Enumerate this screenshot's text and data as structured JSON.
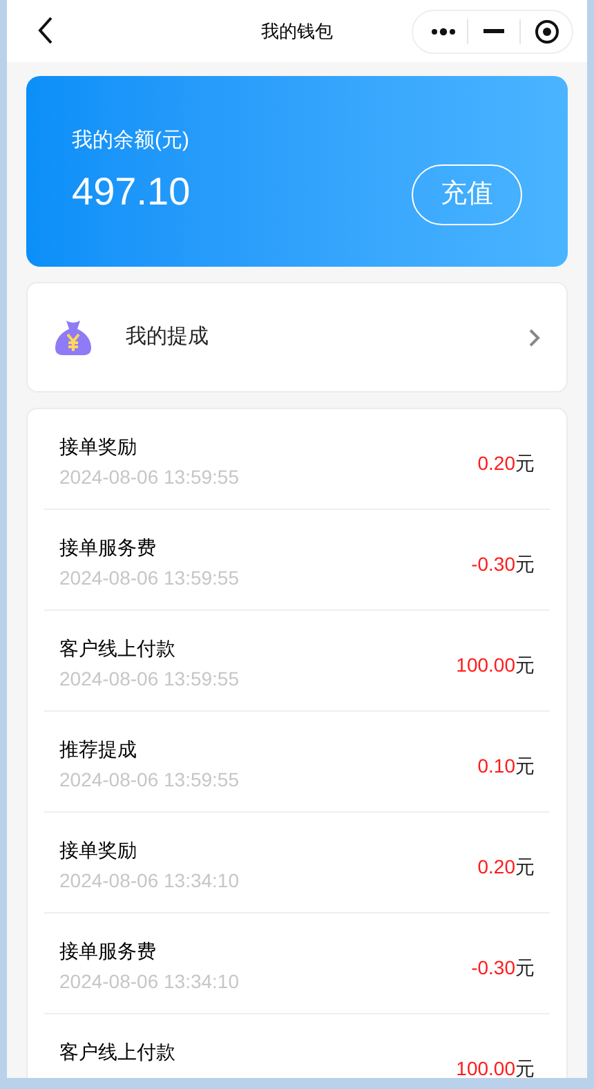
{
  "nav": {
    "title": "我的钱包"
  },
  "balance": {
    "label": "我的余额(元)",
    "amount": "497.10",
    "button": "充值"
  },
  "commission": {
    "label": "我的提成"
  },
  "transactions": [
    {
      "title": "接单奖励",
      "time": "2024-08-06 13:59:55",
      "amount": "0.20",
      "unit": "元"
    },
    {
      "title": "接单服务费",
      "time": "2024-08-06 13:59:55",
      "amount": "-0.30",
      "unit": "元"
    },
    {
      "title": "客户线上付款",
      "time": "2024-08-06 13:59:55",
      "amount": "100.00",
      "unit": "元"
    },
    {
      "title": "推荐提成",
      "time": "2024-08-06 13:59:55",
      "amount": "0.10",
      "unit": "元"
    },
    {
      "title": "接单奖励",
      "time": "2024-08-06 13:34:10",
      "amount": "0.20",
      "unit": "元"
    },
    {
      "title": "接单服务费",
      "time": "2024-08-06 13:34:10",
      "amount": "-0.30",
      "unit": "元"
    },
    {
      "title": "客户线上付款",
      "amount": "100.00",
      "unit": "元"
    }
  ]
}
